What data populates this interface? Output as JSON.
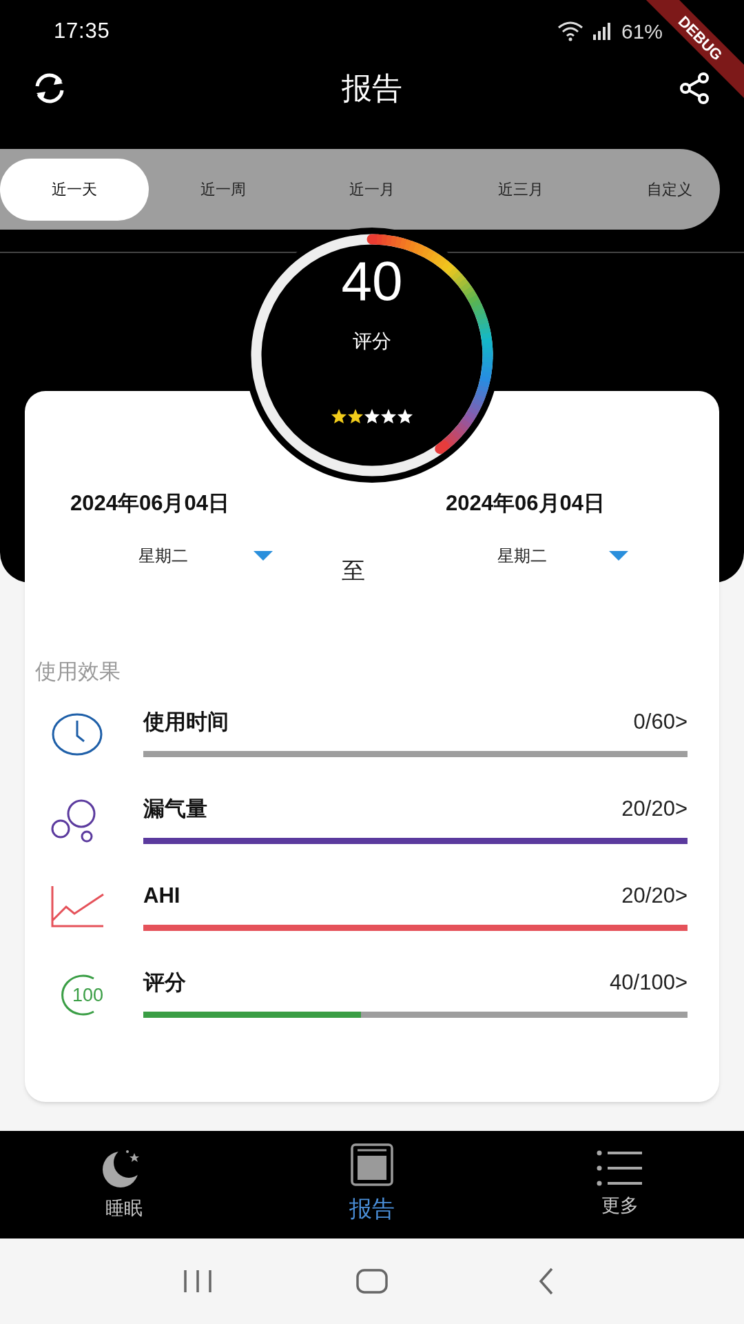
{
  "status_bar": {
    "time": "17:35",
    "battery": "61%"
  },
  "debug_banner": "DEBUG",
  "app_bar": {
    "title": "报告"
  },
  "tabs": [
    {
      "label": "近一天",
      "selected": true
    },
    {
      "label": "近一周",
      "selected": false
    },
    {
      "label": "近一月",
      "selected": false
    },
    {
      "label": "近三月",
      "selected": false
    },
    {
      "label": "自定义",
      "selected": false
    }
  ],
  "gauge": {
    "value": "40",
    "label": "评分",
    "stars": 2
  },
  "date_range": {
    "start_date": "2024年06月04日",
    "start_weekday": "星期二",
    "separator": "至",
    "end_date": "2024年06月04日",
    "end_weekday": "星期二"
  },
  "section_title": "使用效果",
  "metrics": [
    {
      "kind": "clock",
      "label": "使用时间",
      "value": "0/60>",
      "level": 0,
      "color": "#1e5fa8"
    },
    {
      "kind": "bubbles",
      "label": "漏气量",
      "value": "20/20>",
      "level": 1,
      "color": "#5b3a9e"
    },
    {
      "kind": "chart",
      "label": "AHI",
      "value": "20/20>",
      "level": 1,
      "color": "#e5525a"
    },
    {
      "kind": "score",
      "label": "评分",
      "value": "40/100>",
      "level": 0.4,
      "color": "#3a9e45",
      "icon_text": "100"
    }
  ],
  "bottom_nav": [
    {
      "kind": "moon",
      "label": "睡眠",
      "selected": false
    },
    {
      "kind": "report",
      "label": "报告",
      "selected": true
    },
    {
      "kind": "list",
      "label": "更多",
      "selected": false
    }
  ]
}
